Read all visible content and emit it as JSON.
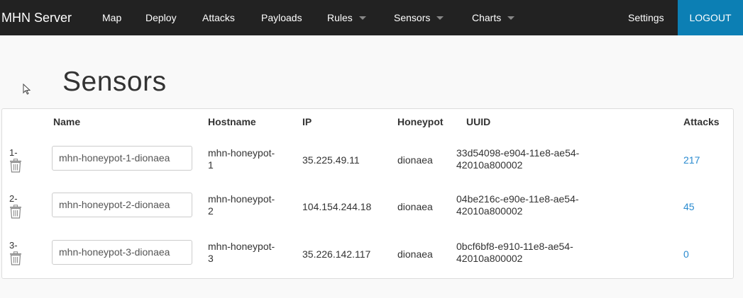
{
  "navbar": {
    "brand": "MHN Server",
    "items": [
      {
        "label": "Map",
        "dropdown": false
      },
      {
        "label": "Deploy",
        "dropdown": false
      },
      {
        "label": "Attacks",
        "dropdown": false
      },
      {
        "label": "Payloads",
        "dropdown": false
      },
      {
        "label": "Rules",
        "dropdown": true
      },
      {
        "label": "Sensors",
        "dropdown": true
      },
      {
        "label": "Charts",
        "dropdown": true
      }
    ],
    "settings": "Settings",
    "logout": "LOGOUT"
  },
  "page": {
    "title": "Sensors"
  },
  "table": {
    "columns": [
      "Name",
      "Hostname",
      "IP",
      "Honeypot",
      "UUID",
      "Attacks"
    ],
    "rows": [
      {
        "index": "1-",
        "name": "mhn-honeypot-1-dionaea",
        "hostname_line1": "mhn-honeypot-",
        "hostname_line2": "1",
        "ip": "35.225.49.11",
        "honeypot": "dionaea",
        "uuid_line1": "33d54098-e904-11e8-ae54-",
        "uuid_line2": "42010a800002",
        "attacks": "217"
      },
      {
        "index": "2-",
        "name": "mhn-honeypot-2-dionaea",
        "hostname_line1": "mhn-honeypot-",
        "hostname_line2": "2",
        "ip": "104.154.244.18",
        "honeypot": "dionaea",
        "uuid_line1": "04be216c-e90e-11e8-ae54-",
        "uuid_line2": "42010a800002",
        "attacks": "45"
      },
      {
        "index": "3-",
        "name": "mhn-honeypot-3-dionaea",
        "hostname_line1": "mhn-honeypot-",
        "hostname_line2": "3",
        "ip": "35.226.142.117",
        "honeypot": "dionaea",
        "uuid_line1": "0bcf6bf8-e910-11e8-ae54-",
        "uuid_line2": "42010a800002",
        "attacks": "0"
      }
    ]
  },
  "colors": {
    "navbar_bg": "#222222",
    "logout_bg": "#0c7fb4",
    "link": "#2a8bd0"
  }
}
